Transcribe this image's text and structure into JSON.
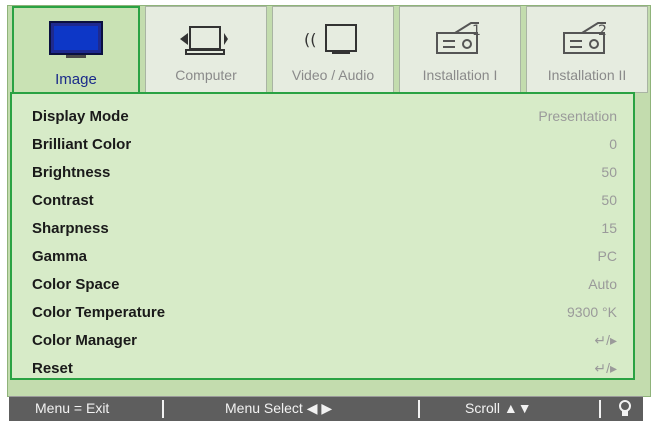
{
  "tabs": [
    {
      "label": "Image",
      "icon": "monitor-icon",
      "active": true
    },
    {
      "label": "Computer",
      "icon": "computer-icon",
      "active": false
    },
    {
      "label": "Video / Audio",
      "icon": "video-audio-icon",
      "active": false
    },
    {
      "label": "Installation I",
      "icon": "projector-1-icon",
      "active": false
    },
    {
      "label": "Installation II",
      "icon": "projector-2-icon",
      "active": false
    }
  ],
  "menu": [
    {
      "name": "Display Mode",
      "value": "Presentation"
    },
    {
      "name": "Brilliant Color",
      "value": "0"
    },
    {
      "name": "Brightness",
      "value": "50"
    },
    {
      "name": "Contrast",
      "value": "50"
    },
    {
      "name": "Sharpness",
      "value": "15"
    },
    {
      "name": "Gamma",
      "value": "PC"
    },
    {
      "name": "Color Space",
      "value": "Auto"
    },
    {
      "name": "Color Temperature",
      "value": "9300 °K"
    },
    {
      "name": "Color Manager",
      "value": "↵/▸"
    },
    {
      "name": "Reset",
      "value": "↵/▸"
    }
  ],
  "footer": {
    "exit": "Menu = Exit",
    "select": "Menu Select ◀ ▶",
    "scroll": "Scroll ▲▼",
    "lamp_icon": "bulb-icon"
  },
  "colors": {
    "accent_green": "#2aa243",
    "panel_bg": "#d7ebc8",
    "footer_bg": "#5e5e5e",
    "active_label": "#1a2a8a"
  }
}
